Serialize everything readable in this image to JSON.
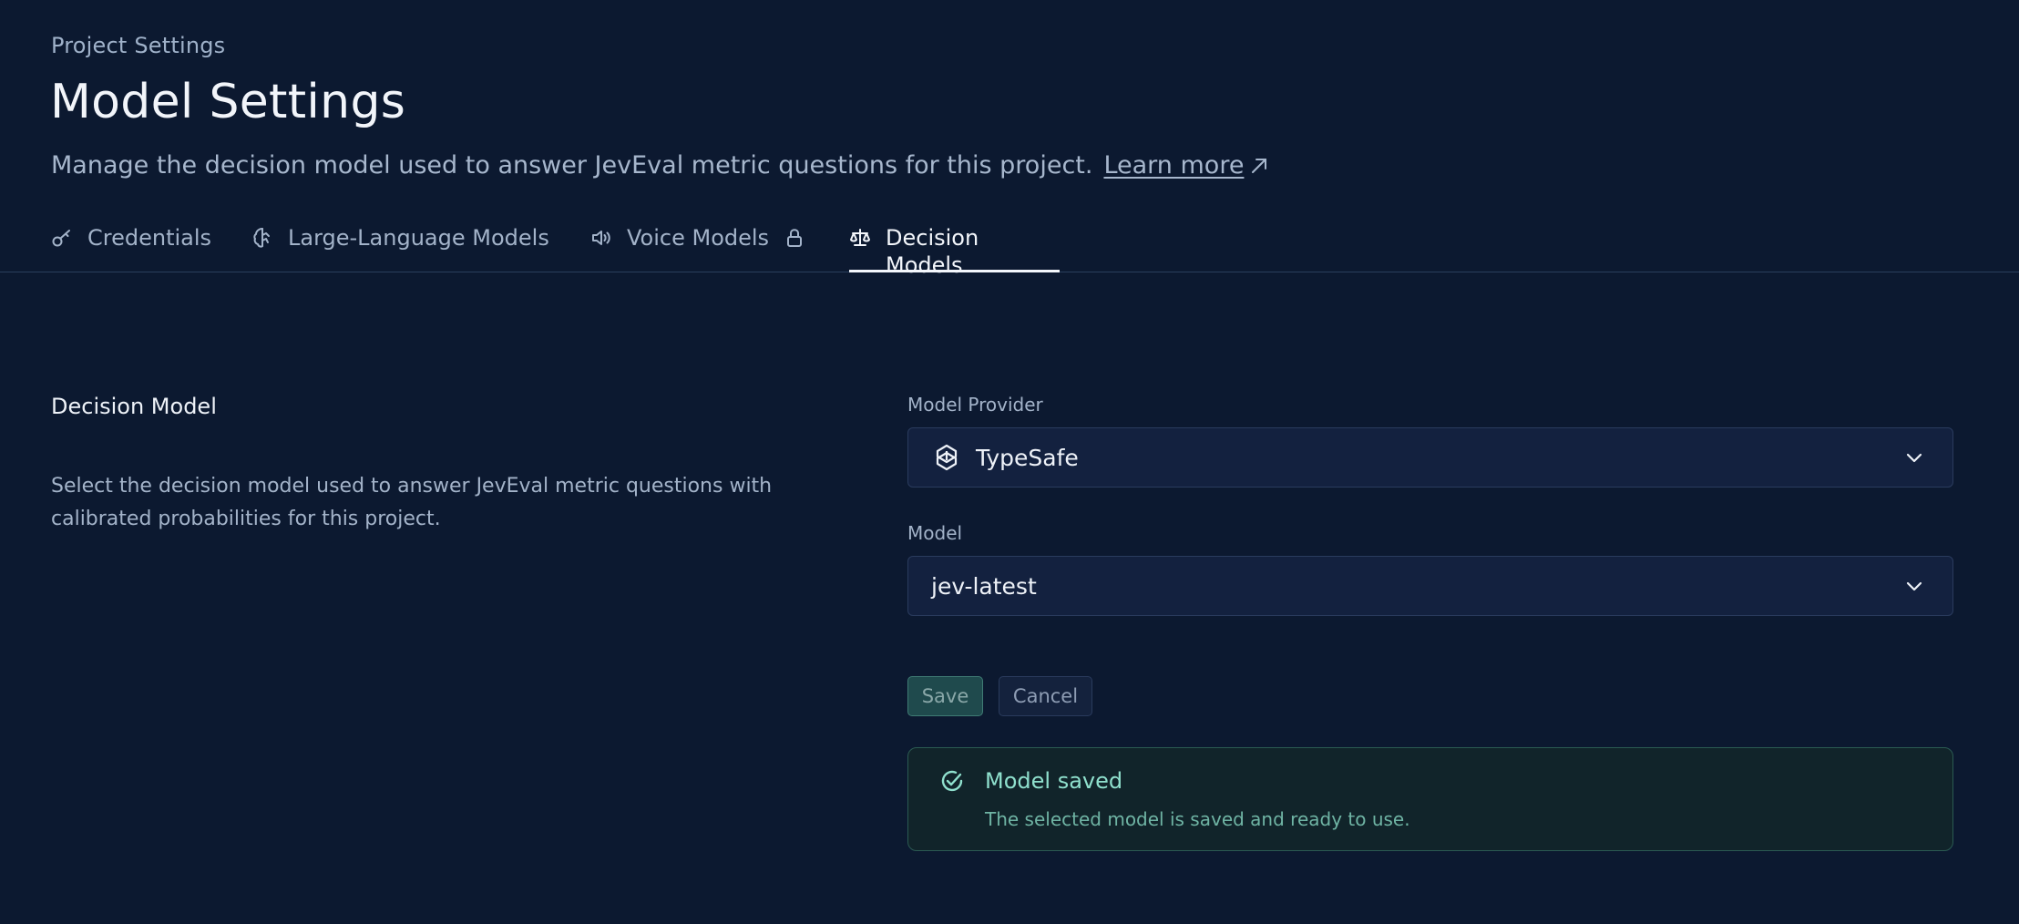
{
  "header": {
    "eyebrow": "Project Settings",
    "title": "Model Settings",
    "subtitle": "Manage the decision model used to answer JevEval metric questions for this project.",
    "learn_more": "Learn more"
  },
  "tabs": [
    {
      "label": "Credentials",
      "icon": "key-icon",
      "locked": false,
      "active": false
    },
    {
      "label": "Large-Language Models",
      "icon": "brain-icon",
      "locked": false,
      "active": false
    },
    {
      "label": "Voice Models",
      "icon": "speaker-icon",
      "locked": true,
      "active": false
    },
    {
      "label": "Decision Models",
      "icon": "scale-icon",
      "locked": false,
      "active": true
    }
  ],
  "section": {
    "title": "Decision Model",
    "description": "Select the decision model used to answer JevEval metric questions with calibrated probabilities for this project."
  },
  "form": {
    "provider_label": "Model Provider",
    "provider_value": "TypeSafe",
    "model_label": "Model",
    "model_value": "jev-latest",
    "save_label": "Save",
    "cancel_label": "Cancel"
  },
  "toast": {
    "title": "Model saved",
    "message": "The selected model is saved and ready to use."
  },
  "colors": {
    "background": "#0c1930",
    "input_bg": "#13213f",
    "success_text": "#8fe0cd",
    "save_button_bg": "#1f4a4d"
  }
}
